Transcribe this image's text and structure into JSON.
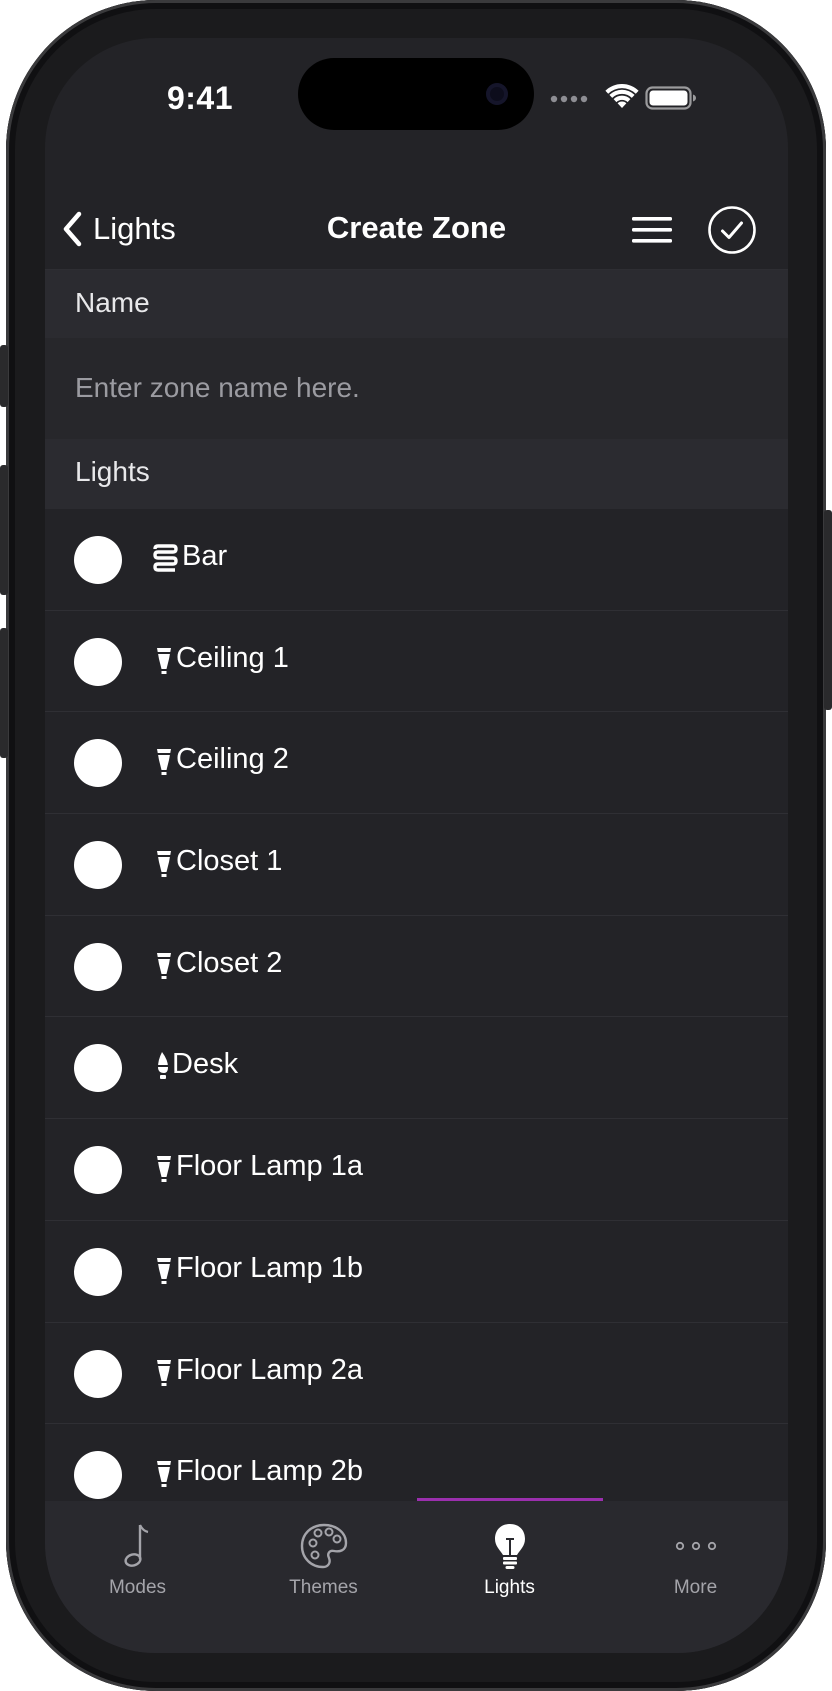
{
  "status_bar": {
    "time": "9:41"
  },
  "navbar": {
    "back_label": "Lights",
    "title": "Create Zone",
    "back_icon": "chevron-left-icon",
    "menu_icon": "hamburger-icon",
    "done_icon": "checkmark-circle-icon"
  },
  "name_section": {
    "header": "Name",
    "placeholder": "Enter zone name here.",
    "value": ""
  },
  "lights_section": {
    "header": "Lights",
    "items": [
      {
        "label": "Bar",
        "icon": "lightstrip-icon",
        "selected": false
      },
      {
        "label": "Ceiling 1",
        "icon": "spot-bulb-icon",
        "selected": false
      },
      {
        "label": "Ceiling 2",
        "icon": "spot-bulb-icon",
        "selected": false
      },
      {
        "label": "Closet 1",
        "icon": "spot-bulb-icon",
        "selected": false
      },
      {
        "label": "Closet 2",
        "icon": "spot-bulb-icon",
        "selected": false
      },
      {
        "label": "Desk",
        "icon": "candle-bulb-icon",
        "selected": false
      },
      {
        "label": "Floor Lamp 1a",
        "icon": "spot-bulb-icon",
        "selected": false
      },
      {
        "label": "Floor Lamp 1b",
        "icon": "spot-bulb-icon",
        "selected": false
      },
      {
        "label": "Floor Lamp 2a",
        "icon": "spot-bulb-icon",
        "selected": false
      },
      {
        "label": "Floor Lamp 2b",
        "icon": "spot-bulb-icon",
        "selected": false
      }
    ]
  },
  "tabbar": {
    "tabs": [
      {
        "label": "Modes",
        "icon": "music-note-icon",
        "active": false
      },
      {
        "label": "Themes",
        "icon": "palette-icon",
        "active": false
      },
      {
        "label": "Lights",
        "icon": "lightbulb-icon",
        "active": true
      },
      {
        "label": "More",
        "icon": "ellipsis-icon",
        "active": false
      }
    ]
  },
  "colors": {
    "background": "#232327",
    "section_header": "#2b2b30",
    "accent": "#9b2fae",
    "text": "#ffffff",
    "placeholder": "#9b9ba1"
  }
}
